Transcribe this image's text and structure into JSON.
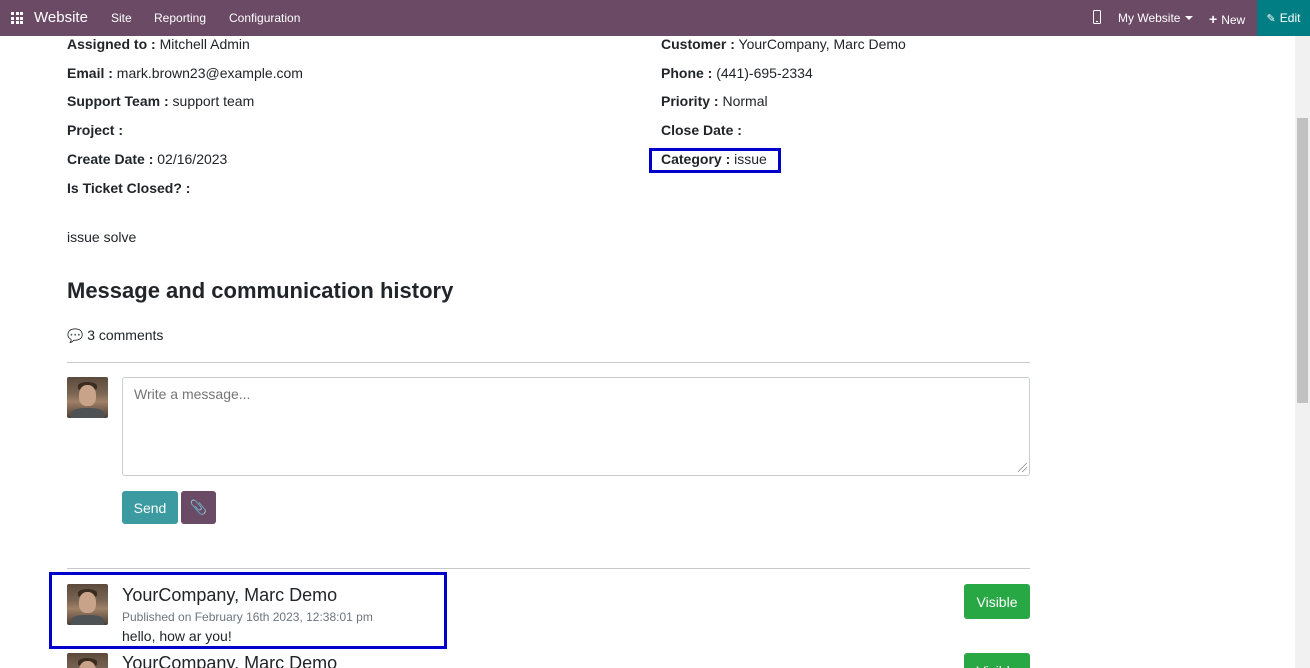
{
  "navbar": {
    "brand": "Website",
    "menu": [
      "Site",
      "Reporting",
      "Configuration"
    ],
    "my_website": "My Website",
    "new_label": "New",
    "edit_label": "Edit",
    "background": "#6b4a65",
    "edit_background": "#017e84"
  },
  "ticket": {
    "left_fields": [
      {
        "label": "Assigned to :",
        "value": "Mitchell Admin"
      },
      {
        "label": "Email :",
        "value": "mark.brown23@example.com"
      },
      {
        "label": "Support Team :",
        "value": "support team"
      },
      {
        "label": "Project :",
        "value": ""
      },
      {
        "label": "Create Date :",
        "value": "02/16/2023"
      },
      {
        "label": "Is Ticket Closed? :",
        "value": ""
      }
    ],
    "right_fields": [
      {
        "label": "Customer :",
        "value": "YourCompany, Marc Demo"
      },
      {
        "label": "Phone :",
        "value": "(441)-695-2334"
      },
      {
        "label": "Priority :",
        "value": "Normal"
      },
      {
        "label": "Close Date :",
        "value": ""
      },
      {
        "label": "Category :",
        "value": "issue"
      }
    ],
    "description": "issue solve"
  },
  "history": {
    "title": "Message and communication history",
    "comments_count": "3 comments",
    "placeholder": "Write a message...",
    "send_label": "Send",
    "messages": [
      {
        "author": "YourCompany, Marc Demo",
        "published": "Published on February 16th 2023, 12:38:01 pm",
        "text": "hello, how ar you!",
        "visibility": "Visible"
      },
      {
        "author": "YourCompany, Marc Demo",
        "visibility": "Visible"
      }
    ]
  },
  "colors": {
    "highlight_border": "#0000cc",
    "send_button": "#3b9ba0",
    "visible_button": "#28a745"
  }
}
